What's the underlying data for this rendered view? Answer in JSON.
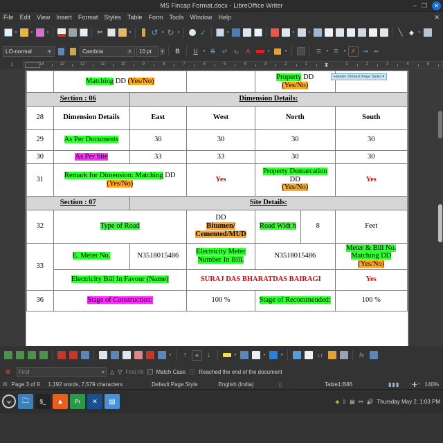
{
  "window": {
    "title": "MS Fincap Format.docx - LibreOffice Writer",
    "minimize": "–",
    "maximize": "❐",
    "close": "✕"
  },
  "menubar": {
    "items": [
      "File",
      "Edit",
      "View",
      "Insert",
      "Format",
      "Styles",
      "Table",
      "Form",
      "Tools",
      "Window",
      "Help"
    ],
    "doc_close": "✕"
  },
  "standard_toolbar": {
    "icons": [
      "new-document-icon",
      "open-file-icon",
      "save-icon",
      "export-pdf-icon",
      "print-icon",
      "print-preview-icon",
      "cut-icon",
      "copy-icon",
      "paste-icon",
      "clone-formatting-icon",
      "undo-icon",
      "redo-icon",
      "find-replace-icon",
      "spelling-icon",
      "insert-table-icon",
      "insert-image-icon",
      "insert-chart-icon",
      "insert-textbox-icon",
      "page-break-icon",
      "insert-field-icon",
      "insert-special-char-icon",
      "insert-hyperlink-icon",
      "insert-footnote-icon",
      "insert-endnote-icon",
      "insert-bookmark-icon",
      "insert-crossref-icon",
      "insert-comment-icon",
      "track-changes-icon",
      "insert-line-icon",
      "basic-shapes-icon",
      "show-draw-functions-icon"
    ]
  },
  "formatting_toolbar": {
    "paragraph_style": "LO-normal",
    "font_name": "Cambria",
    "font_size": "10 pt",
    "icons": [
      "update-style-icon",
      "new-style-icon",
      "bold-icon",
      "italic-icon",
      "underline-icon",
      "strikethrough-icon",
      "superscript-icon",
      "subscript-icon",
      "clear-formatting-icon",
      "font-color-icon",
      "highlight-color-icon",
      "align-left-icon",
      "bullet-list-icon",
      "number-list-icon",
      "increase-indent-icon",
      "decrease-indent-icon"
    ]
  },
  "ruler": {
    "left_label": "L",
    "ticks": [
      "14",
      "13",
      "12",
      "11",
      "10",
      "9",
      "8",
      "7",
      "6",
      "5",
      "4",
      "3",
      "2",
      "1",
      "",
      "1",
      "2",
      "3",
      "4",
      "5"
    ]
  },
  "document": {
    "header_button": "Header (Default Page Style)  ▾",
    "top_partial_row": {
      "c1": "",
      "c2_green": "Matching",
      "c2_plain": " DD ",
      "c2_orange": "(Yes/No)",
      "c3": "",
      "c4_green": "Property",
      "c4_plain": " DD",
      "c4_orange": "(Yes/No)",
      "c5": ""
    },
    "section06": {
      "label": "Section : 06",
      "title": "Dimension Details:"
    },
    "row28": {
      "num": "28",
      "label": "Dimension Details",
      "east": "East",
      "west": "West",
      "north": "North",
      "south": "South"
    },
    "row29": {
      "num": "29",
      "label": "As Per Documents",
      "east": "30",
      "west": "30",
      "north": "30",
      "south": "30"
    },
    "row30": {
      "num": "30",
      "label": "As Per Site",
      "east": "33",
      "west": "33",
      "north": "30",
      "south": "30"
    },
    "row31": {
      "num": "31",
      "label_green": "Remark for Dimension: Matching",
      "label_plain": " DD ",
      "label_orange": "(Yes/No)",
      "value1": "Yes",
      "label2_green": "Property Demarcation",
      "label2_plain": " DD ",
      "label2_orange": "(Yes/No)",
      "value2": "Yes"
    },
    "section07": {
      "label": "Section : 07",
      "title": "Site Details:"
    },
    "row32": {
      "num": "32",
      "label": "Type  of Road",
      "dd": "DD",
      "options": "Bitumen/ Cemented/MUD",
      "road_width": "Road Widt h",
      "width_value": "8",
      "unit": "Feet"
    },
    "row33": {
      "num": "33",
      "label": "E. Meter No.",
      "meter_no": "N3518015486",
      "label2": "Electricity Meter Number In Bill.",
      "bill_meter_no": "N3518015486",
      "label3_green": "Meter & Bill No. Matching DD",
      "label3_orange": "(Yes/No)"
    },
    "row33b": {
      "label": "Electricity Bill In Favour (Name)",
      "name": "SURAJ DAS BHARATDAS BAIRAGI",
      "matching": "Yes"
    },
    "row36": {
      "num": "36",
      "label": "Stage of Construction:",
      "value": "100 %",
      "label2": "Stage of Recommended:",
      "value2": "100 %"
    }
  },
  "table_toolbar": {
    "icons": [
      "insert-row-above-icon",
      "insert-row-below-icon",
      "insert-column-left-icon",
      "insert-column-right-icon",
      "delete-row-icon",
      "delete-column-icon",
      "delete-table-icon",
      "select-table-icon",
      "select-column-icon",
      "select-row-icon",
      "select-cell-icon",
      "merge-cells-icon",
      "split-cells-icon",
      "optimize-size-icon",
      "align-top-icon",
      "align-center-vertical-icon",
      "align-bottom-icon",
      "table-background-color-icon",
      "borders-icon",
      "border-style-icon",
      "border-color-icon",
      "table-properties-icon",
      "insert-caption-icon",
      "sort-icon",
      "protect-cells-icon",
      "unprotect-cells-icon",
      "sum-icon",
      "number-format-icon"
    ]
  },
  "findbar": {
    "close_icon": "close-icon",
    "placeholder": "Find",
    "find_previous": "△",
    "find_next": "▽",
    "find_all": "Find All",
    "match_case": "Match Case",
    "info_icon": "info-icon",
    "message": "Reached the end of the document"
  },
  "statusbar": {
    "page": "Page 3 of 9",
    "words": "1,192 words, 7,579 characters",
    "page_style": "Default Page Style",
    "language": "English (India)",
    "table_cell": "Table1:B86",
    "zoom": "140%"
  },
  "taskbar": {
    "launcher": "launcher-icon",
    "apps": [
      "files-icon",
      "terminal-icon",
      "vlc-icon",
      "premiere-icon",
      "vlc-cone-icon",
      "writer-icon"
    ],
    "tray": [
      "dropbox-icon",
      "bluetooth-icon",
      "battery-icon",
      "network-icon",
      "volume-icon"
    ],
    "clock": "Thursday May 2, 1:03 PM"
  },
  "colors": {
    "green_highlight": "#33ff33",
    "orange_highlight": "#ffa829",
    "magenta_highlight": "#ff2fff",
    "red_text": "#e00000",
    "section_bg": "#d6d6d6",
    "accent_blue": "#1a6fd4"
  }
}
